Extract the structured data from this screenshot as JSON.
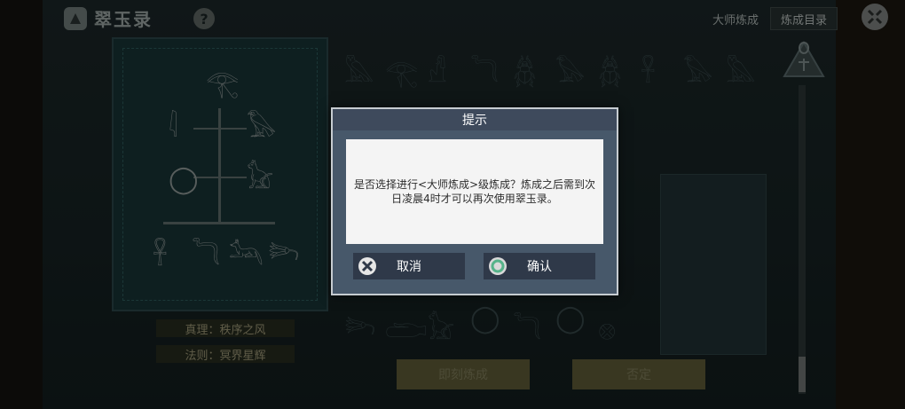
{
  "header": {
    "title": "翠玉录",
    "help_symbol": "?",
    "master_label": "大师炼成",
    "catalog_button": "炼成目录"
  },
  "left_panel": {
    "truth_label": "真理：秩序之风",
    "law_label": "法则：冥界星辉"
  },
  "bottom": {
    "instant_label": "即刻炼成",
    "confirm_label": "否定"
  },
  "dialog": {
    "title": "提示",
    "message": "是否选择进行<大师炼成>级炼成？炼成之后需到次日凌晨4时才可以再次使用翠玉录。",
    "cancel_label": "取消",
    "confirm_label": "确认"
  },
  "icons": [
    "eye-of-horus-icon",
    "scarab-icon",
    "close-icon",
    "ankh-icon"
  ],
  "colors": {
    "dialog_frame": "#c7ccd1",
    "dialog_bg": "#47586a",
    "button_bg": "#2f3949"
  }
}
